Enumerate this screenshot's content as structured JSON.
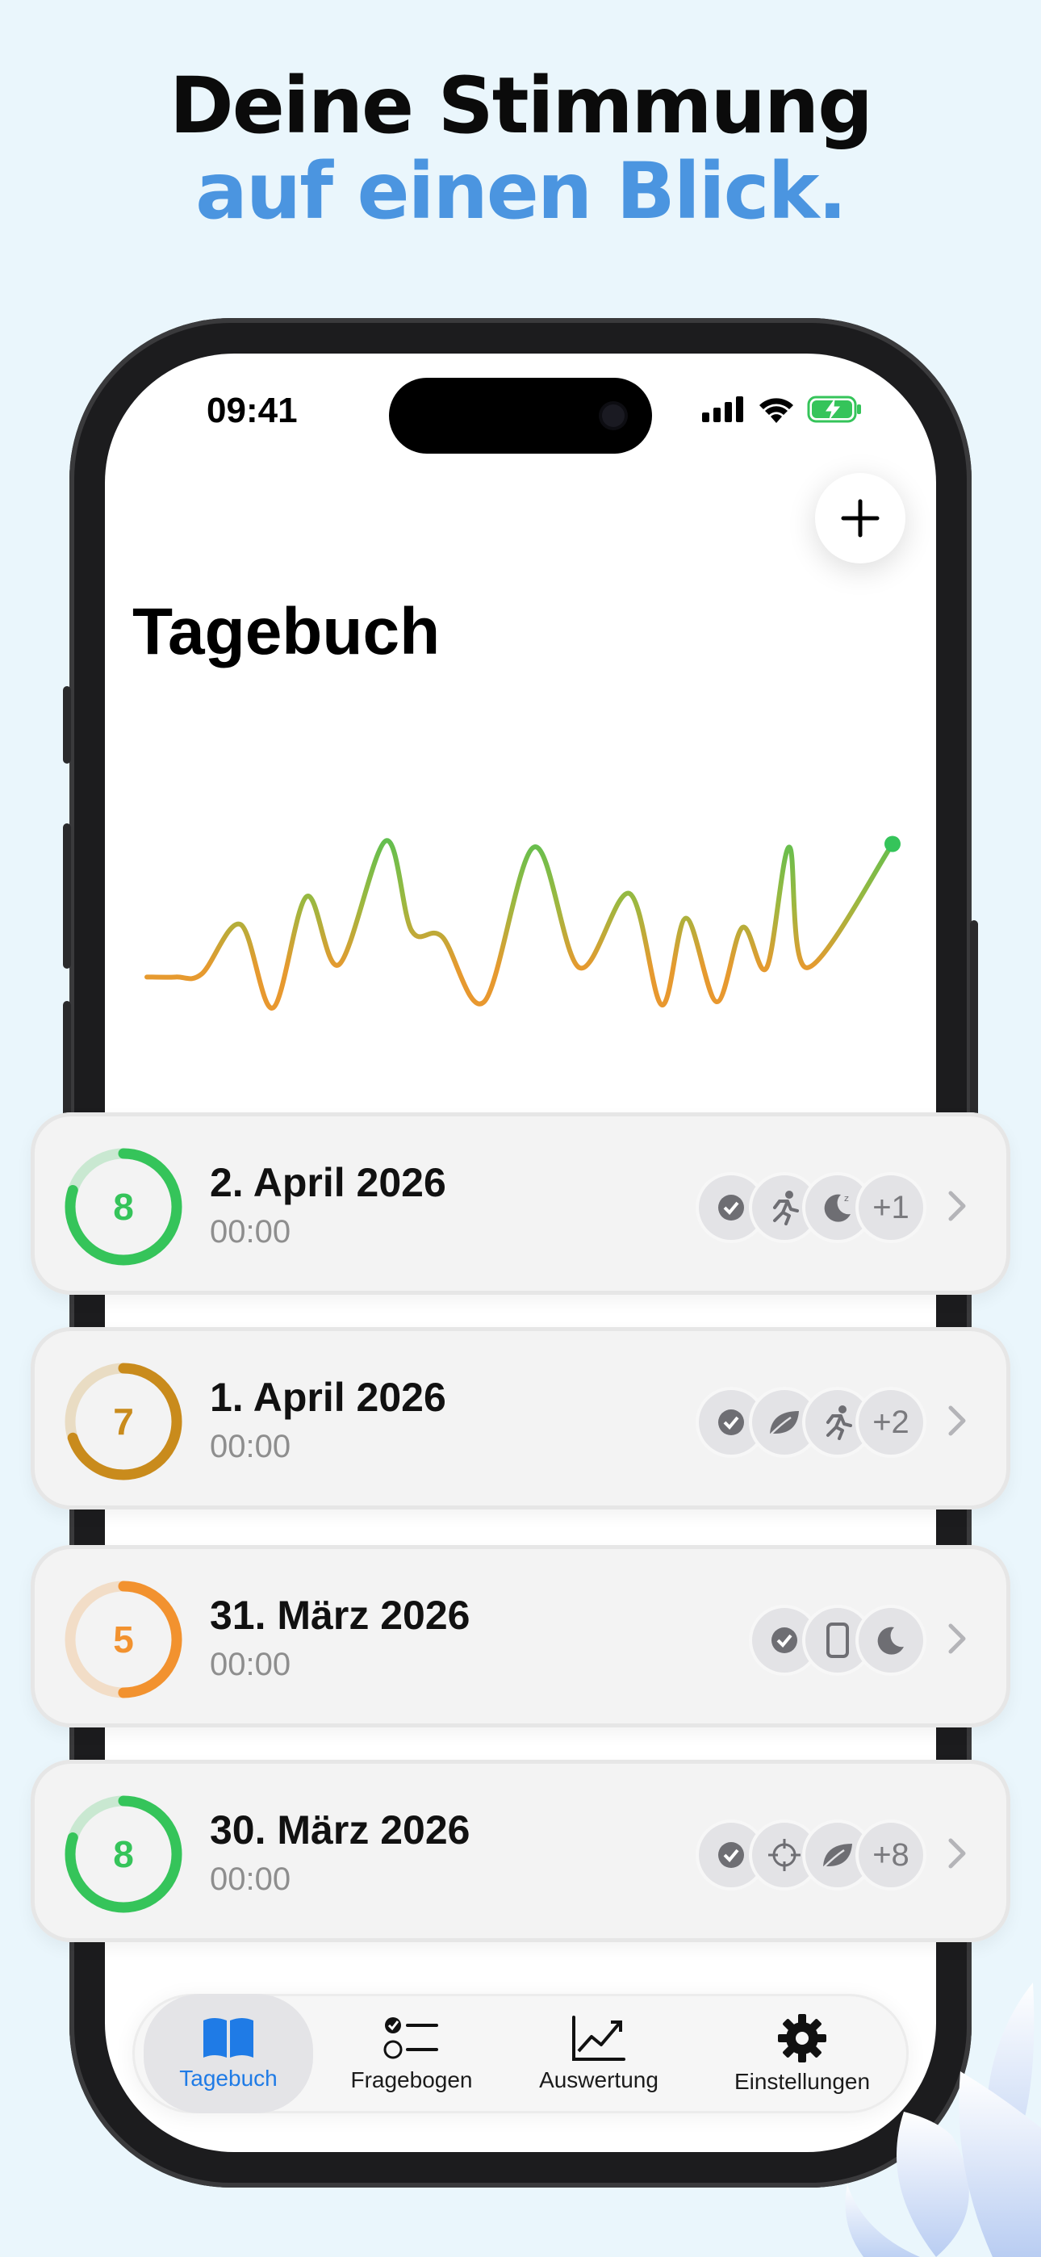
{
  "headline": {
    "line1": "Deine Stimmung",
    "line2": "auf einen Blick."
  },
  "status_bar": {
    "time": "09:41"
  },
  "page_title": "Tagebuch",
  "chart_data": {
    "type": "line",
    "title": "",
    "xlabel": "",
    "ylabel": "",
    "ylim": [
      1,
      10
    ],
    "values": [
      4.2,
      4.2,
      4.3,
      5.9,
      3.2,
      6.8,
      4.6,
      8.6,
      5.7,
      5.5,
      3.4,
      8.4,
      4.5,
      6.9,
      3.3,
      6.1,
      3.4,
      5.8,
      4.5,
      8.4,
      4.5,
      8.5
    ]
  },
  "entries": [
    {
      "score": "8",
      "date": "2. April 2026",
      "time": "00:00",
      "color": "#35c45a",
      "fraction": 0.8,
      "badges": [
        "check-icon",
        "running-icon",
        "sleep-moon-icon"
      ],
      "more": "+1"
    },
    {
      "score": "7",
      "date": "1. April 2026",
      "time": "00:00",
      "color": "#c98b1c",
      "fraction": 0.7,
      "badges": [
        "check-icon",
        "leaf-icon",
        "running-icon"
      ],
      "more": "+2"
    },
    {
      "score": "5",
      "date": "31. März 2026",
      "time": "00:00",
      "color": "#f2922f",
      "fraction": 0.5,
      "badges": [
        "check-icon",
        "phone-icon",
        "moon-icon"
      ],
      "more": ""
    },
    {
      "score": "8",
      "date": "30. März 2026",
      "time": "00:00",
      "color": "#35c45a",
      "fraction": 0.8,
      "badges": [
        "check-icon",
        "target-icon",
        "leaf-icon"
      ],
      "more": "+8"
    }
  ],
  "tabs": [
    {
      "label": "Tagebuch",
      "icon": "book-icon",
      "active": true
    },
    {
      "label": "Fragebogen",
      "icon": "checklist-icon",
      "active": false
    },
    {
      "label": "Auswertung",
      "icon": "chart-icon",
      "active": false
    },
    {
      "label": "Einstellungen",
      "icon": "gear-icon",
      "active": false
    }
  ],
  "colors": {
    "accent": "#1f7be6",
    "headline_blue": "#4b95e0",
    "good": "#35c45a",
    "mid": "#f2922f"
  }
}
